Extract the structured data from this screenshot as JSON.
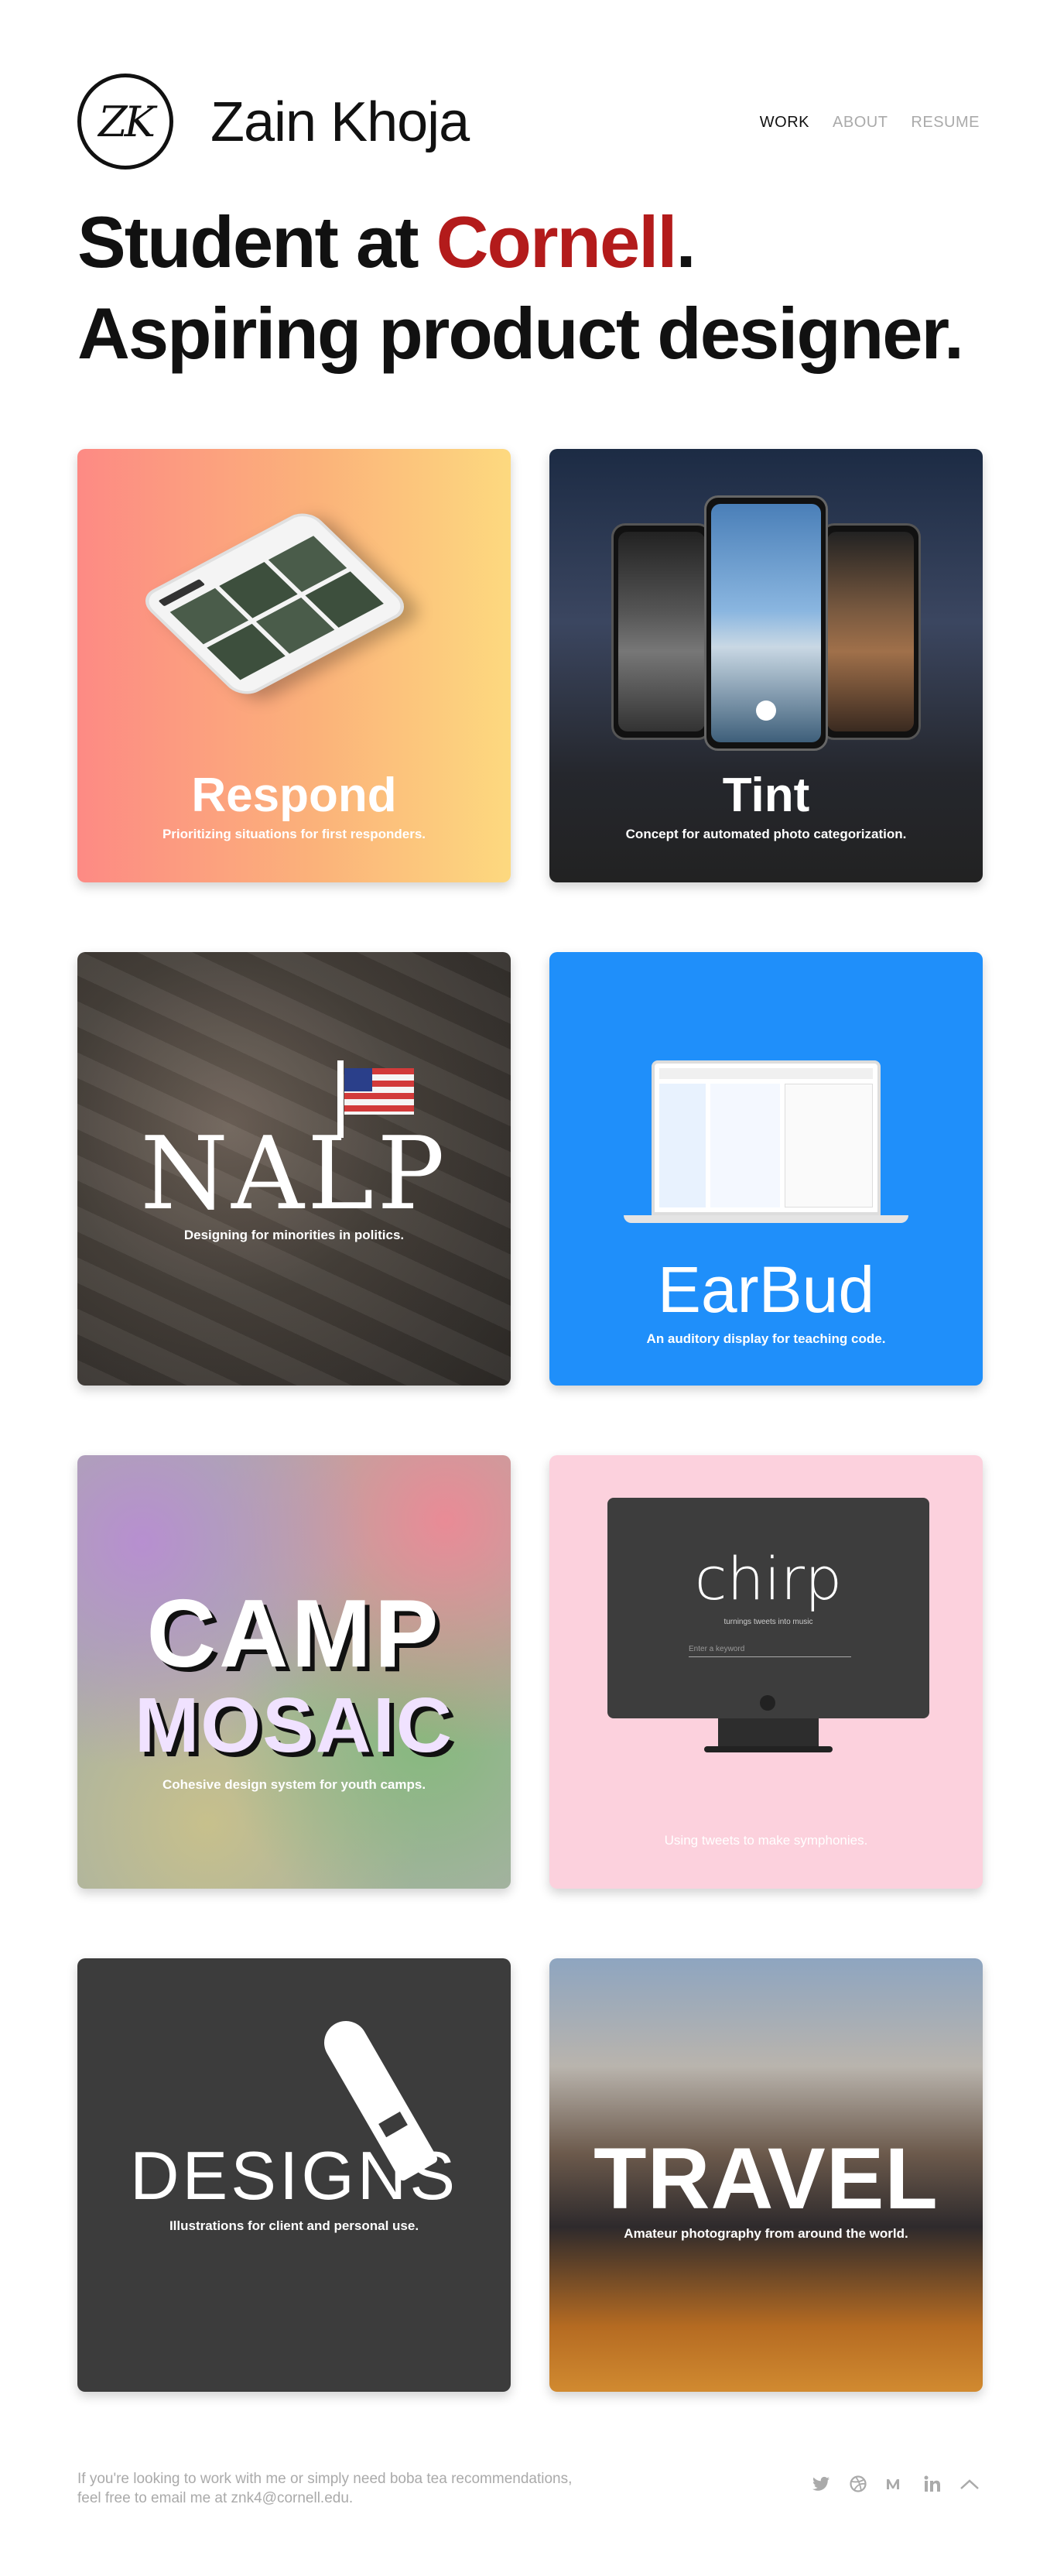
{
  "header": {
    "logo_text": "ZK",
    "site_name": "Zain Khoja",
    "nav": [
      {
        "label": "WORK",
        "active": true
      },
      {
        "label": "ABOUT",
        "active": false
      },
      {
        "label": "RESUME",
        "active": false
      }
    ]
  },
  "hero": {
    "line1_prefix": "Student at ",
    "line1_accent": "Cornell",
    "line1_suffix": ".",
    "line2": "Aspiring product designer.",
    "accent_color": "#b31b1b"
  },
  "projects": [
    {
      "title": "Respond",
      "subtitle": "Prioritizing situations for first responders."
    },
    {
      "title": "Tint",
      "subtitle": "Concept for automated photo categorization."
    },
    {
      "title": "NALP",
      "subtitle": "Designing for minorities in politics."
    },
    {
      "title": "EarBud",
      "subtitle": "An auditory display for teaching code."
    },
    {
      "title_line1": "CAMP",
      "title_line2": "MOSAIC",
      "subtitle": "Cohesive design system for youth camps."
    },
    {
      "title": "chirp",
      "tagline": "turnings tweets into music",
      "input_placeholder": "Enter a keyword",
      "subtitle": "Using tweets to make symphonies."
    },
    {
      "title": "DESIGNS",
      "subtitle": "Illustrations for client and personal use."
    },
    {
      "title": "TRAVEL",
      "subtitle": "Amateur photography from around the world."
    }
  ],
  "footer": {
    "line1": "If you're looking to work with me or simply need boba tea recommendations,",
    "line2": "feel free to email me at znk4@cornell.edu.",
    "icons": [
      "twitter-icon",
      "dribbble-icon",
      "medium-icon",
      "linkedin-icon",
      "chevron-up-icon"
    ]
  }
}
